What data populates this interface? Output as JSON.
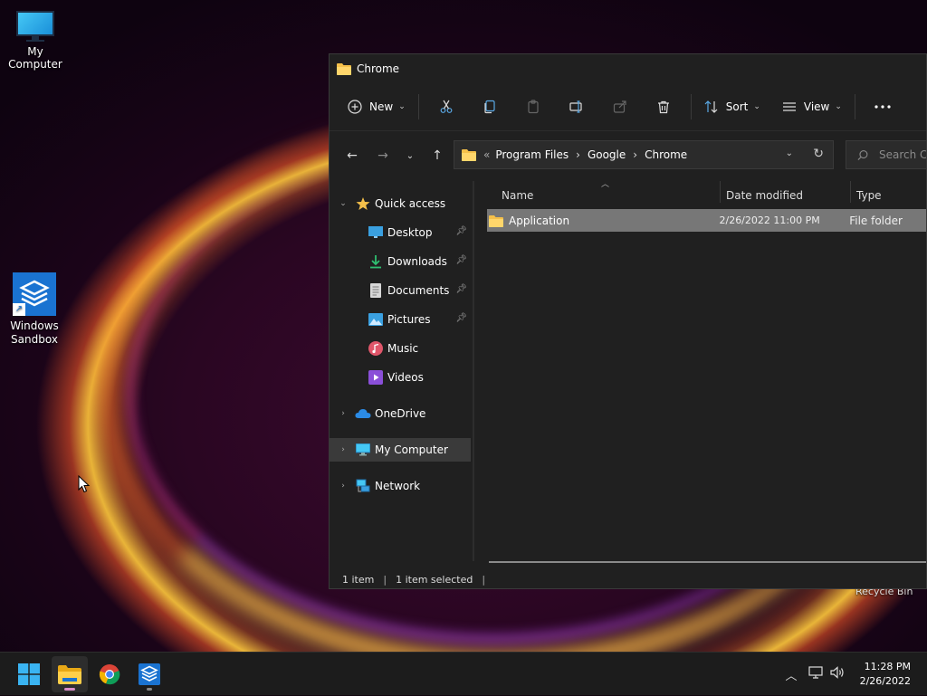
{
  "desktop": {
    "icons": [
      {
        "label": "My Computer"
      },
      {
        "label": "Windows Sandbox"
      }
    ],
    "recycle_bin_label": "Recycle Bin"
  },
  "explorer": {
    "title": "Chrome",
    "toolbar": {
      "new_label": "New",
      "sort_label": "Sort",
      "view_label": "View"
    },
    "address": {
      "overflow": "«",
      "crumbs": [
        "Program Files",
        "Google",
        "Chrome"
      ]
    },
    "search": {
      "placeholder": "Search Chrome"
    },
    "nav": {
      "quick_access": "Quick access",
      "items": [
        {
          "label": "Desktop",
          "pinned": true
        },
        {
          "label": "Downloads",
          "pinned": true
        },
        {
          "label": "Documents",
          "pinned": true
        },
        {
          "label": "Pictures",
          "pinned": true
        },
        {
          "label": "Music",
          "pinned": false
        },
        {
          "label": "Videos",
          "pinned": false
        }
      ],
      "onedrive": "OneDrive",
      "my_computer": "My Computer",
      "network": "Network"
    },
    "columns": [
      "Name",
      "Date modified",
      "Type"
    ],
    "rows": [
      {
        "name": "Application",
        "date": "2/26/2022 11:00 PM",
        "type": "File folder"
      }
    ],
    "status": {
      "count": "1 item",
      "selected": "1 item selected"
    }
  },
  "taskbar": {
    "time": "11:28 PM",
    "date": "2/26/2022"
  },
  "colors": {
    "accent": "#1a73d1",
    "folder": "#f5c04a",
    "selection": "#777777"
  }
}
